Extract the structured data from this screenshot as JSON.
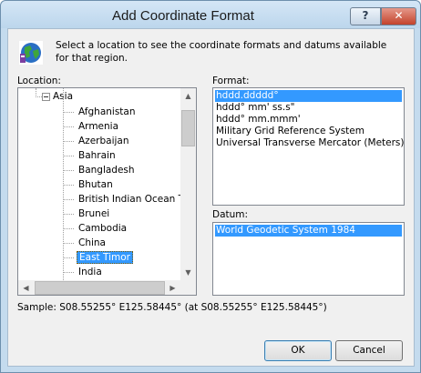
{
  "window": {
    "title": "Add Coordinate Format",
    "help_label": "?",
    "close_label": "✕"
  },
  "intro_text": "Select a location to see the coordinate formats and datums available for that region.",
  "location": {
    "label": "Location:",
    "parent": "Asia",
    "items": [
      "Afghanistan",
      "Armenia",
      "Azerbaijan",
      "Bahrain",
      "Bangladesh",
      "Bhutan",
      "British Indian Ocean Ter",
      "Brunei",
      "Cambodia",
      "China",
      "East Timor",
      "India"
    ],
    "selected": "East Timor"
  },
  "format": {
    "label": "Format:",
    "options": [
      "hddd.ddddd°",
      "hddd° mm' ss.s\"",
      "hddd° mm.mmm'",
      "Military Grid Reference System",
      "Universal Transverse Mercator (Meters)"
    ],
    "selected": "hddd.ddddd°"
  },
  "datum": {
    "label": "Datum:",
    "options": [
      "World Geodetic System 1984"
    ],
    "selected": "World Geodetic System 1984"
  },
  "sample_text": "Sample: S08.55255° E125.58445° (at S08.55255° E125.58445°)",
  "buttons": {
    "ok": "OK",
    "cancel": "Cancel"
  },
  "colors": {
    "selection": "#3399ff",
    "frame": "#c4dbee",
    "close": "#c3432c"
  },
  "icons": {
    "app": "globe-map-icon",
    "expander": "tree-collapse-icon"
  }
}
